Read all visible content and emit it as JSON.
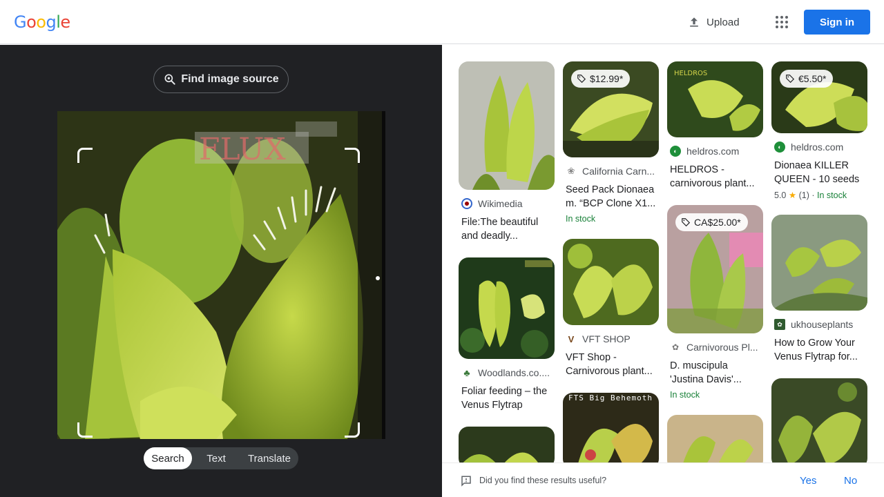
{
  "header": {
    "logo_letters": [
      "G",
      "o",
      "o",
      "g",
      "l",
      "e"
    ],
    "logo_colors": [
      "#4285f4",
      "#ea4335",
      "#fbbc05",
      "#4285f4",
      "#34a853",
      "#ea4335"
    ],
    "upload_label": "Upload",
    "apps_icon": "apps-grid-icon",
    "sign_in_label": "Sign in"
  },
  "left": {
    "find_source_label": "Find image source",
    "mode_tabs": [
      {
        "label": "Search",
        "active": true
      },
      {
        "label": "Text",
        "active": false
      },
      {
        "label": "Translate",
        "active": false
      }
    ]
  },
  "results": [
    {
      "source": "Wikimedia",
      "title": "File:The beautiful and deadly...",
      "price": "",
      "meta": ""
    },
    {
      "source": "California Carn...",
      "title": "Seed Pack Dionaea m. “BCP Clone X1...",
      "price": "$12.99*",
      "meta": "In stock"
    },
    {
      "source": "heldros.com",
      "title": "HELDROS - carnivorous plant...",
      "price": "",
      "meta": ""
    },
    {
      "source": "heldros.com",
      "title": "Dionaea KILLER QUEEN - 10 seeds",
      "price": "€5.50*",
      "rating": "5.0",
      "rating_count": "(1)",
      "meta": "In stock"
    },
    {
      "source": "Woodlands.co....",
      "title": "Foliar feeding – the Venus Flytrap",
      "price": "",
      "meta": ""
    },
    {
      "source": "VFT SHOP",
      "title": "VFT Shop - Carnivorous plant...",
      "price": "",
      "meta": ""
    },
    {
      "source": "Carnivorous Pl...",
      "title": "D. muscipula 'Justina Davis'...",
      "price": "CA$25.00*",
      "meta": "In stock"
    },
    {
      "source": "ukhouseplants",
      "title": "How to Grow Your Venus Flytrap for...",
      "price": "",
      "meta": ""
    },
    {
      "source": "",
      "title": "",
      "price": "",
      "meta": "",
      "overlay_text": "FTS Big Behemoth"
    }
  ],
  "feedback": {
    "question": "Did you find these results useful?",
    "yes_label": "Yes",
    "no_label": "No"
  },
  "colors": {
    "accent": "#1a73e8",
    "in_stock": "#188038",
    "left_bg": "#202124"
  }
}
